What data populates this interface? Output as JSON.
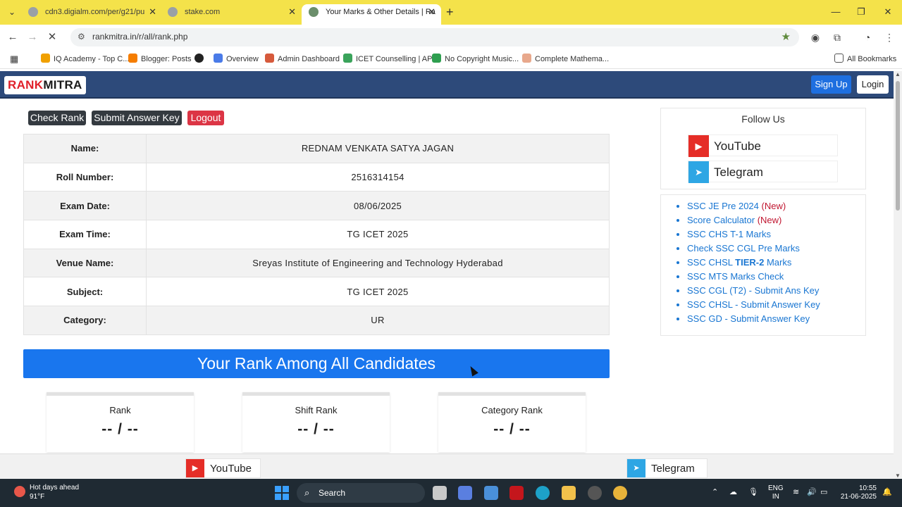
{
  "browser": {
    "tabs": [
      {
        "title": "cdn3.digialm.com/per/g21/pu",
        "active": false
      },
      {
        "title": "stake.com",
        "active": false
      },
      {
        "title": "Your Marks & Other Details | Ra",
        "active": true
      }
    ],
    "url": "rankmitra.in/r/all/rank.php",
    "bookmarks": [
      "IQ Academy - Top C...",
      "Blogger: Posts",
      "Overview",
      "Admin Dashboard",
      "ICET Counselling | AP",
      "No Copyright Music...",
      "Complete Mathema..."
    ],
    "all_bookmarks": "All Bookmarks"
  },
  "site": {
    "logo_rank": "RANK",
    "logo_mitra": "MITRA",
    "signup": "Sign Up",
    "login": "Login",
    "actions": {
      "check_rank": "Check Rank",
      "submit_key": "Submit Answer Key",
      "logout": "Logout"
    },
    "details": [
      {
        "label": "Name:",
        "value": "REDNAM VENKATA SATYA JAGAN"
      },
      {
        "label": "Roll Number:",
        "value": "2516314154"
      },
      {
        "label": "Exam Date:",
        "value": "08/06/2025"
      },
      {
        "label": "Exam Time:",
        "value": "TG ICET 2025"
      },
      {
        "label": "Venue Name:",
        "value": "Sreyas Institute of Engineering and Technology Hyderabad"
      },
      {
        "label": "Subject:",
        "value": "TG ICET 2025"
      },
      {
        "label": "Category:",
        "value": "UR"
      }
    ],
    "rank_banner": "Your Rank Among All Candidates",
    "rank_cards": [
      {
        "label": "Rank",
        "value": "-- / --"
      },
      {
        "label": "Shift Rank",
        "value": "-- / --"
      },
      {
        "label": "Category Rank",
        "value": "-- / --"
      }
    ],
    "sidebar": {
      "follow_title": "Follow Us",
      "youtube": "YouTube",
      "telegram": "Telegram",
      "links": [
        {
          "text": "SSC JE Pre 2024 ",
          "tag": "(New)"
        },
        {
          "text": "Score Calculator ",
          "tag": "(New)"
        },
        {
          "text": "SSC CHS T-1 Marks",
          "tag": ""
        },
        {
          "text": "Check SSC CGL Pre Marks",
          "tag": ""
        },
        {
          "text": "SSC CHSL ",
          "bold": "TIER-2",
          "after": " Marks"
        },
        {
          "text": "SSC MTS Marks Check",
          "tag": ""
        },
        {
          "text": "SSC CGL (T2) - Submit Ans Key",
          "tag": ""
        },
        {
          "text": "SSC CHSL - Submit Answer Key",
          "tag": ""
        },
        {
          "text": "SSC GD - Submit Answer Key",
          "tag": ""
        }
      ]
    },
    "sticky": {
      "youtube": "YouTube",
      "telegram": "Telegram"
    }
  },
  "taskbar": {
    "weather_title": "Hot days ahead",
    "weather_temp": "91°F",
    "search": "Search",
    "lang_1": "ENG",
    "lang_2": "IN",
    "time": "10:55",
    "date": "21-06-2025"
  },
  "colors": {
    "header": "#2d4a7a",
    "banner": "#1976ee",
    "link": "#1976d2",
    "new": "#c0152f",
    "logout": "#dc3545"
  }
}
